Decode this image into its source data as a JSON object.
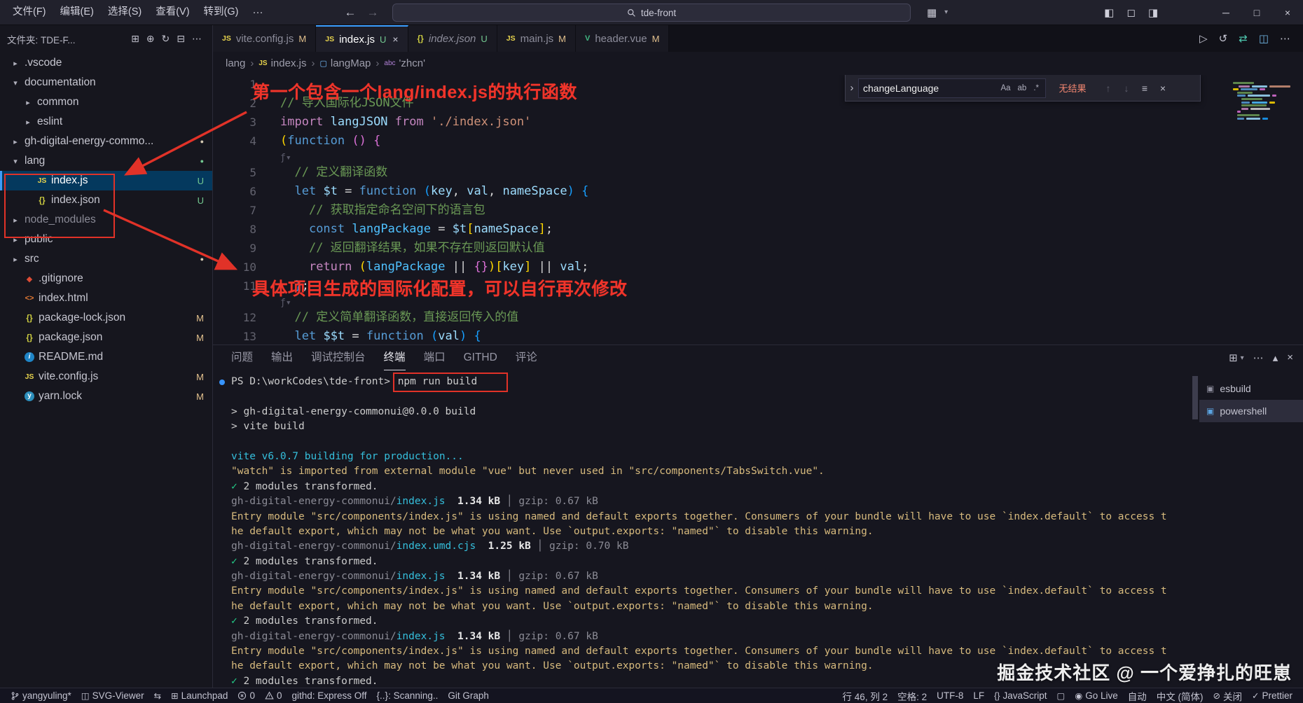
{
  "titlebar": {
    "menus": [
      "文件(F)",
      "编辑(E)",
      "选择(S)",
      "查看(V)",
      "转到(G)"
    ],
    "overflow": "···",
    "search": "tde-front"
  },
  "icons": {
    "back": "←",
    "forward": "→",
    "chevron-right": "›",
    "customize-layout": "▦",
    "layout-dropdown": "▾",
    "toggle-sidebar": "◧",
    "toggle-panel": "◻",
    "toggle-secondary": "◨",
    "minimize": "─",
    "maximize": "□",
    "close": "×",
    "new-file": "⊞",
    "new-folder": "⊕",
    "refresh": "↻",
    "collapse-all": "⊟",
    "more": "⋯",
    "run": "▷",
    "timeline": "↺",
    "sync": "⇄",
    "split": "◫",
    "find-prev": "↑",
    "find-next": "↓",
    "find-selection": "≡",
    "panel-new": "⊞",
    "panel-chevron": "▾",
    "panel-max": "▴",
    "twisty-open": "▾",
    "twisty-closed": "▸",
    "check": "✓",
    "compare": "⇆",
    "grid": "⊞",
    "preview": "◫",
    "braces": "{}",
    "browser": "▢",
    "broadcast": "◉",
    "blocked": "⊘",
    "dot": "●",
    "fold-inlay": "ƒ▾",
    "term-icon": "▣"
  },
  "tabs": [
    {
      "label": "vite.config.js",
      "icon": "js",
      "badge": "M"
    },
    {
      "label": "index.js",
      "icon": "js",
      "badge": "U",
      "active": true
    },
    {
      "label": "index.json",
      "icon": "json",
      "badge": "U",
      "italic": true
    },
    {
      "label": "main.js",
      "icon": "js",
      "badge": "M"
    },
    {
      "label": "header.vue",
      "icon": "vue",
      "badge": "M"
    }
  ],
  "editor_actions": [
    "run",
    "timeline",
    "sync",
    "split",
    "more"
  ],
  "breadcrumb": [
    {
      "label": "lang"
    },
    {
      "label": "index.js",
      "icon": "js"
    },
    {
      "label": "langMap",
      "icon": "sym-var"
    },
    {
      "label": "'zhcn'",
      "icon": "sym-str"
    }
  ],
  "find": {
    "value": "changeLanguage",
    "toggles": [
      "Aa",
      "ab",
      ".*"
    ],
    "status": "无结果"
  },
  "explorer": {
    "title": "文件夹: TDE-F...",
    "toolbar": [
      "new-file",
      "new-folder",
      "refresh",
      "collapse-all",
      "more"
    ],
    "items": [
      {
        "l": ".vscode",
        "d": 0,
        "t": "folder"
      },
      {
        "l": "documentation",
        "d": 0,
        "t": "folder",
        "e": true
      },
      {
        "l": "common",
        "d": 1,
        "t": "folder"
      },
      {
        "l": "eslint",
        "d": 1,
        "t": "folder"
      },
      {
        "l": "gh-digital-energy-commo...",
        "d": 0,
        "t": "folder",
        "dot": "mod"
      },
      {
        "l": "lang",
        "d": 0,
        "t": "folder",
        "e": true,
        "dot": "new"
      },
      {
        "l": "index.js",
        "d": 1,
        "t": "file",
        "i": "js",
        "b": "U",
        "sel": true
      },
      {
        "l": "index.json",
        "d": 1,
        "t": "file",
        "i": "json",
        "b": "U"
      },
      {
        "l": "node_modules",
        "d": 0,
        "t": "folder",
        "dim": true
      },
      {
        "l": "public",
        "d": 0,
        "t": "folder"
      },
      {
        "l": "src",
        "d": 0,
        "t": "folder",
        "dot": "mod"
      },
      {
        "l": ".gitignore",
        "d": 0,
        "t": "file",
        "i": "git"
      },
      {
        "l": "index.html",
        "d": 0,
        "t": "file",
        "i": "html"
      },
      {
        "l": "package-lock.json",
        "d": 0,
        "t": "file",
        "i": "json",
        "b": "M"
      },
      {
        "l": "package.json",
        "d": 0,
        "t": "file",
        "i": "json",
        "b": "M"
      },
      {
        "l": "README.md",
        "d": 0,
        "t": "file",
        "i": "info"
      },
      {
        "l": "vite.config.js",
        "d": 0,
        "t": "file",
        "i": "js",
        "b": "M"
      },
      {
        "l": "yarn.lock",
        "d": 0,
        "t": "file",
        "i": "yarn",
        "b": "M"
      }
    ]
  },
  "editor": {
    "lines": [
      {
        "n": "1",
        "s": []
      },
      {
        "n": "2",
        "s": [
          [
            "// 导入国际化JSON文件",
            "cm"
          ]
        ]
      },
      {
        "n": "3",
        "s": [
          [
            "import ",
            "kw"
          ],
          [
            "langJSON",
            "var"
          ],
          [
            " ",
            "pl"
          ],
          [
            "from",
            "kw"
          ],
          [
            " ",
            "pl"
          ],
          [
            "'./index.json'",
            "str"
          ]
        ]
      },
      {
        "n": "4",
        "s": [
          [
            "(",
            "b1"
          ],
          [
            "function",
            "st"
          ],
          [
            " ",
            "pl"
          ],
          [
            "()",
            "b2"
          ],
          [
            " ",
            "pl"
          ],
          [
            "{",
            "b2"
          ]
        ]
      },
      {
        "inlay": true
      },
      {
        "n": "5",
        "s": [
          [
            "  ",
            "pl"
          ],
          [
            "// 定义翻译函数",
            "cm"
          ]
        ]
      },
      {
        "n": "6",
        "s": [
          [
            "  ",
            "pl"
          ],
          [
            "let",
            "st"
          ],
          [
            " ",
            "pl"
          ],
          [
            "$t",
            "var"
          ],
          [
            " = ",
            "pl"
          ],
          [
            "function",
            "st"
          ],
          [
            " ",
            "pl"
          ],
          [
            "(",
            "b3"
          ],
          [
            "key",
            "var"
          ],
          [
            ", ",
            "pl"
          ],
          [
            "val",
            "var"
          ],
          [
            ", ",
            "pl"
          ],
          [
            "nameSpace",
            "var"
          ],
          [
            ")",
            "b3"
          ],
          [
            " ",
            "pl"
          ],
          [
            "{",
            "b3"
          ]
        ]
      },
      {
        "n": "7",
        "s": [
          [
            "    ",
            "pl"
          ],
          [
            "// 获取指定命名空间下的语言包",
            "cm"
          ]
        ]
      },
      {
        "n": "8",
        "s": [
          [
            "    ",
            "pl"
          ],
          [
            "const",
            "st"
          ],
          [
            " ",
            "pl"
          ],
          [
            "langPackage",
            "var2"
          ],
          [
            " = ",
            "pl"
          ],
          [
            "$t",
            "var"
          ],
          [
            "[",
            "b1"
          ],
          [
            "nameSpace",
            "var"
          ],
          [
            "]",
            "b1"
          ],
          [
            ";",
            "pl"
          ]
        ]
      },
      {
        "n": "9",
        "s": [
          [
            "    ",
            "pl"
          ],
          [
            "// 返回翻译结果，如果不存在则返回默认值",
            "cm"
          ]
        ]
      },
      {
        "n": "10",
        "s": [
          [
            "    ",
            "pl"
          ],
          [
            "return",
            "kw"
          ],
          [
            " ",
            "pl"
          ],
          [
            "(",
            "b1"
          ],
          [
            "langPackage",
            "var2"
          ],
          [
            " ",
            "pl"
          ],
          [
            "||",
            "pl"
          ],
          [
            " ",
            "pl"
          ],
          [
            "{}",
            "b2"
          ],
          [
            ")",
            "b1"
          ],
          [
            "[",
            "b1"
          ],
          [
            "key",
            "var"
          ],
          [
            "]",
            "b1"
          ],
          [
            " ",
            "pl"
          ],
          [
            "||",
            "pl"
          ],
          [
            " ",
            "pl"
          ],
          [
            "val",
            "var"
          ],
          [
            ";",
            "pl"
          ]
        ]
      },
      {
        "n": "11",
        "s": [
          [
            "  ",
            "pl"
          ],
          [
            "}",
            "b3"
          ],
          [
            ";",
            "pl"
          ]
        ]
      },
      {
        "inlay": true
      },
      {
        "n": "12",
        "s": [
          [
            "  ",
            "pl"
          ],
          [
            "// 定义简单翻译函数，直接返回传入的值",
            "cm"
          ]
        ]
      },
      {
        "n": "13",
        "s": [
          [
            "  ",
            "pl"
          ],
          [
            "let",
            "st"
          ],
          [
            " ",
            "pl"
          ],
          [
            "$$t",
            "var"
          ],
          [
            " = ",
            "pl"
          ],
          [
            "function",
            "st"
          ],
          [
            " ",
            "pl"
          ],
          [
            "(",
            "b3"
          ],
          [
            "val",
            "var"
          ],
          [
            ")",
            "b3"
          ],
          [
            " ",
            "pl"
          ],
          [
            "{",
            "b3"
          ]
        ]
      }
    ]
  },
  "annotations": {
    "note1": "第一个包含一个lang/index.js的执行函数",
    "note2": "具体项目生成的国际化配置，可以自行再次修改"
  },
  "panel": {
    "tabs": [
      {
        "label": "问题"
      },
      {
        "label": "输出"
      },
      {
        "label": "调试控制台"
      },
      {
        "label": "终端",
        "active": true
      },
      {
        "label": "端口"
      },
      {
        "label": "GITHD"
      },
      {
        "label": "评论"
      }
    ],
    "actions": [
      "panel-new",
      "panel-chevron",
      "more",
      "panel-max",
      "close"
    ],
    "terminal_lines": [
      [
        [
          "PS D:\\workCodes\\tde-front> ",
          "fg"
        ],
        [
          "npm run build",
          "fg",
          "box"
        ]
      ],
      [],
      [
        [
          "> gh-digital-energy-commonui@0.0.0 build",
          "fg"
        ]
      ],
      [
        [
          "> vite build",
          "fg"
        ]
      ],
      [],
      [
        [
          "vite v6.0.7 ",
          "cy"
        ],
        [
          "building for production...",
          "cy"
        ]
      ],
      [
        [
          "\"watch\" is imported from external module \"vue\" but never used in \"src/components/TabsSwitch.vue\".",
          "yl"
        ]
      ],
      [
        [
          "✓",
          "gr"
        ],
        [
          " 2 modules transformed.",
          "fg"
        ]
      ],
      [
        [
          "gh-digital-energy-commonui/",
          "dim"
        ],
        [
          "index.js",
          "fl"
        ],
        [
          "  ",
          "fg"
        ],
        [
          "1.34 kB",
          "bd"
        ],
        [
          " │ gzip: 0.67 kB",
          "dim"
        ]
      ],
      [
        [
          "Entry module \"src/components/index.js\" is using named and default exports together. Consumers of your bundle will have to use `index.default` to access t",
          "yl"
        ]
      ],
      [
        [
          "he default export, which may not be what you want. Use `output.exports: \"named\"` to disable this warning.",
          "yl"
        ]
      ],
      [
        [
          "gh-digital-energy-commonui/",
          "dim"
        ],
        [
          "index.umd.cjs",
          "fl"
        ],
        [
          "  ",
          "fg"
        ],
        [
          "1.25 kB",
          "bd"
        ],
        [
          " │ gzip: 0.70 kB",
          "dim"
        ]
      ],
      [
        [
          "✓",
          "gr"
        ],
        [
          " 2 modules transformed.",
          "fg"
        ]
      ],
      [
        [
          "gh-digital-energy-commonui/",
          "dim"
        ],
        [
          "index.js",
          "fl"
        ],
        [
          "  ",
          "fg"
        ],
        [
          "1.34 kB",
          "bd"
        ],
        [
          " │ gzip: 0.67 kB",
          "dim"
        ]
      ],
      [
        [
          "Entry module \"src/components/index.js\" is using named and default exports together. Consumers of your bundle will have to use `index.default` to access t",
          "yl"
        ]
      ],
      [
        [
          "he default export, which may not be what you want. Use `output.exports: \"named\"` to disable this warning.",
          "yl"
        ]
      ],
      [
        [
          "✓",
          "gr"
        ],
        [
          " 2 modules transformed.",
          "fg"
        ]
      ],
      [
        [
          "gh-digital-energy-commonui/",
          "dim"
        ],
        [
          "index.js",
          "fl"
        ],
        [
          "  ",
          "fg"
        ],
        [
          "1.34 kB",
          "bd"
        ],
        [
          " │ gzip: 0.67 kB",
          "dim"
        ]
      ],
      [
        [
          "Entry module \"src/components/index.js\" is using named and default exports together. Consumers of your bundle will have to use `index.default` to access t",
          "yl"
        ]
      ],
      [
        [
          "he default export, which may not be what you want. Use `output.exports: \"named\"` to disable this warning.",
          "yl"
        ]
      ],
      [
        [
          "✓",
          "gr"
        ],
        [
          " 2 modules transformed.",
          "fg"
        ]
      ]
    ],
    "terminal_list": [
      {
        "label": "esbuild",
        "selected": false
      },
      {
        "label": "powershell",
        "selected": true
      }
    ]
  },
  "statusbar": {
    "left": [
      {
        "icon": "git-branch",
        "label": "yangyuling*"
      },
      {
        "icon": "preview",
        "label": "SVG-Viewer"
      },
      {
        "icon": "compare",
        "label": ""
      },
      {
        "icon": "grid",
        "label": "Launchpad"
      },
      {
        "icon": "error-circle",
        "label": "0"
      },
      {
        "icon": "warning-triangle",
        "label": "0"
      },
      {
        "icon": "",
        "label": "githd: Express Off"
      },
      {
        "icon": "",
        "label": "{..}: Scanning.."
      },
      {
        "icon": "",
        "label": "Git Graph"
      }
    ],
    "right": [
      {
        "icon": "",
        "label": "行 46, 列 2"
      },
      {
        "icon": "",
        "label": "空格: 2"
      },
      {
        "icon": "",
        "label": "UTF-8"
      },
      {
        "icon": "",
        "label": "LF"
      },
      {
        "icon": "braces",
        "label": "JavaScript"
      },
      {
        "icon": "browser",
        "label": ""
      },
      {
        "icon": "broadcast",
        "label": "Go Live"
      },
      {
        "icon": "",
        "label": "自动"
      },
      {
        "icon": "",
        "label": "中文 (简体)"
      },
      {
        "icon": "blocked",
        "label": "关闭"
      },
      {
        "icon": "check",
        "label": "Prettier"
      }
    ]
  },
  "watermark": "掘金技术社区 @ 一个爱挣扎的旺崽"
}
